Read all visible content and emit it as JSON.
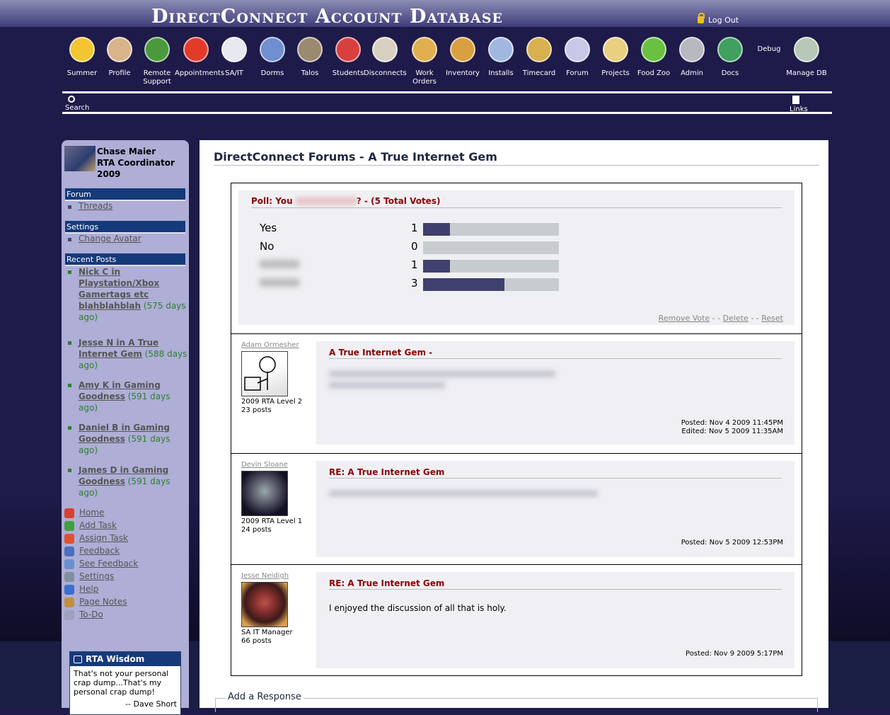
{
  "header": {
    "title": "DirectConnect Account Database",
    "logout": "Log Out"
  },
  "nav": [
    {
      "label": "Summer",
      "icon": "smiley-sunglasses-icon",
      "color": "#f2c531"
    },
    {
      "label": "Profile",
      "icon": "profile-portrait-icon",
      "color": "#d9b48a"
    },
    {
      "label": "Remote Support",
      "icon": "globe-help-icon",
      "color": "#4a9a3d"
    },
    {
      "label": "Appointments",
      "icon": "alarm-clock-icon",
      "color": "#e33a2a"
    },
    {
      "label": "SA/IT",
      "icon": "red-cross-icon",
      "color": "#e8e8f0"
    },
    {
      "label": "Dorms",
      "icon": "building-icon",
      "color": "#6f8fd0"
    },
    {
      "label": "Talos",
      "icon": "helmet-icon",
      "color": "#9a8a70"
    },
    {
      "label": "Students",
      "icon": "student-user-icon",
      "color": "#d84040"
    },
    {
      "label": "Disconnects",
      "icon": "broken-cable-icon",
      "color": "#d8d0c0"
    },
    {
      "label": "Work Orders",
      "icon": "clipboard-pin-icon",
      "color": "#e0b050"
    },
    {
      "label": "Inventory",
      "icon": "box-icon",
      "color": "#d8a040"
    },
    {
      "label": "Installs",
      "icon": "install-disc-icon",
      "color": "#a0b8e0"
    },
    {
      "label": "Timecard",
      "icon": "money-bag-icon",
      "color": "#d8b050"
    },
    {
      "label": "Forum",
      "icon": "speech-bubbles-icon",
      "color": "#c8c8e8"
    },
    {
      "label": "Projects",
      "icon": "folders-icon",
      "color": "#e8d080"
    },
    {
      "label": "Food Zoo",
      "icon": "apple-icon",
      "color": "#6ac040"
    },
    {
      "label": "Admin",
      "icon": "gears-icon",
      "color": "#b8b8c0"
    },
    {
      "label": "Docs",
      "icon": "books-icon",
      "color": "#40a060"
    },
    {
      "label": "Debug",
      "icon": "",
      "color": ""
    },
    {
      "label": "Manage DB",
      "icon": "database-check-icon",
      "color": "#b8c8b8"
    }
  ],
  "subnav": {
    "search": "Search",
    "links": "Links"
  },
  "sidebar": {
    "user_name": "Chase Maier",
    "user_role": "RTA Coordinator 2009",
    "forum_head": "Forum",
    "threads": "Threads",
    "settings_head": "Settings",
    "change_avatar": "Change Avatar",
    "recent_head": "Recent Posts",
    "recent": [
      {
        "who": "Nick C",
        "in": " in ",
        "thread": "Playstation/Xbox Gamertags etc blahblahblah",
        "ago": " (575 days ago)"
      },
      {
        "who": "Jesse N",
        "in": " in ",
        "thread": "A True Internet Gem",
        "ago": " (588 days ago)"
      },
      {
        "who": "Amy K",
        "in": " in ",
        "thread": "Gaming Goodness",
        "ago": " (591 days ago)"
      },
      {
        "who": "Daniel B",
        "in": " in ",
        "thread": "Gaming Goodness",
        "ago": " (591 days ago)"
      },
      {
        "who": "James D",
        "in": " in ",
        "thread": "Gaming Goodness",
        "ago": " (591 days ago)"
      }
    ],
    "tools": [
      {
        "label": "Home",
        "icon": "home-icon",
        "color": "#d84030"
      },
      {
        "label": "Add Task",
        "icon": "checkbox-add-icon",
        "color": "#40a040"
      },
      {
        "label": "Assign Task",
        "icon": "assign-users-icon",
        "color": "#e05030"
      },
      {
        "label": "Feedback",
        "icon": "info-icon",
        "color": "#4a70c0"
      },
      {
        "label": "See Feedback",
        "icon": "magnifier-icon",
        "color": "#6a90d0"
      },
      {
        "label": "Settings",
        "icon": "tools-icon",
        "color": "#8090a0"
      },
      {
        "label": "Help",
        "icon": "help-icon",
        "color": "#3a70d0"
      },
      {
        "label": " Page Notes",
        "icon": "notes-pencil-icon",
        "color": "#c09040"
      },
      {
        "label": "To-Do",
        "icon": "todo-list-icon",
        "color": "#a0a0c0"
      }
    ],
    "wisdom": {
      "title": "RTA Wisdom",
      "quote": "That's not your personal crap dump...That's my personal crap dump!",
      "author": "-- Dave Short"
    }
  },
  "main": {
    "title": "DirectConnect Forums - A True Internet Gem",
    "poll": {
      "prefix": "Poll: You ",
      "suffix": "? - (5 Total Votes)",
      "options": [
        {
          "label": "Yes",
          "count": 1,
          "fraction": 0.2
        },
        {
          "label": "No",
          "count": 0,
          "fraction": 0.0
        },
        {
          "label": "",
          "count": 1,
          "fraction": 0.2
        },
        {
          "label": "",
          "count": 3,
          "fraction": 0.6
        }
      ],
      "remove_vote": "Remove Vote",
      "delete": "Delete",
      "reset": "Reset",
      "sep": " - - "
    },
    "posts": [
      {
        "author": "Adam Ormesher",
        "rank": "2009 RTA Level 2",
        "posts": "23 posts",
        "title": "A True Internet Gem -",
        "body": "",
        "posted": "Posted: Nov 4 2009 11:45PM",
        "edited": "Edited: Nov 5 2009 11:35AM"
      },
      {
        "author": "Devin Sloane",
        "rank": "2009 RTA Level 1",
        "posts": "24 posts",
        "title": "RE: A True Internet Gem",
        "body": "",
        "posted": "Posted: Nov 5 2009 12:53PM",
        "edited": ""
      },
      {
        "author": "Jesse Neidigh",
        "rank": "SA IT Manager",
        "posts": "66 posts",
        "title": "RE: A True Internet Gem",
        "body": "I enjoyed the discussion of all that is holy.",
        "posted": "Posted: Nov 9 2009 5:17PM",
        "edited": ""
      }
    ],
    "respond": "Add a Response"
  }
}
